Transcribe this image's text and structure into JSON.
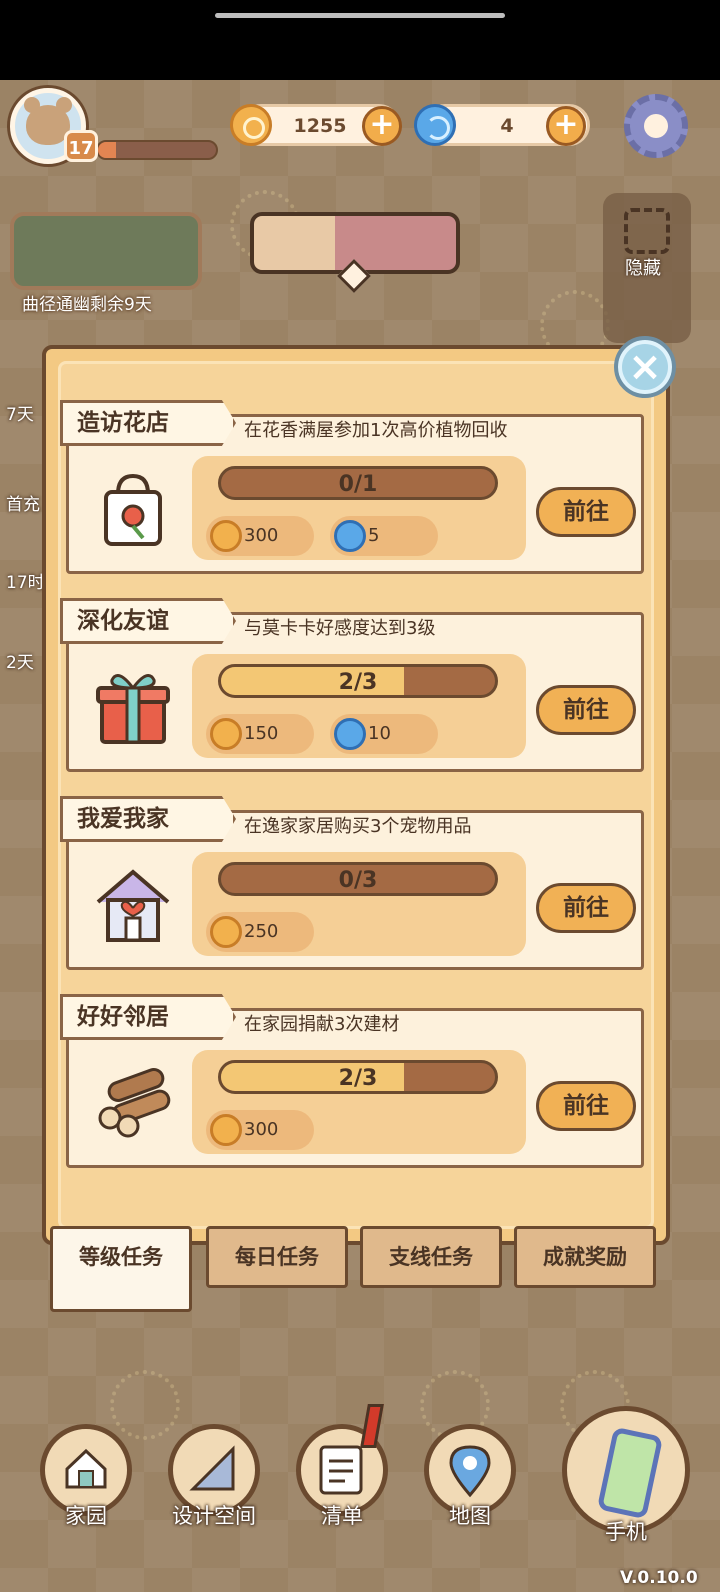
{
  "hud": {
    "level": "17",
    "xp_fraction": 0.15,
    "coins": "1255",
    "gems": "4"
  },
  "side": {
    "event_caption": "曲径通幽剩余9天",
    "hide_label": "隐藏",
    "strip_texts": [
      "7天",
      "首充",
      "17时",
      "2天"
    ]
  },
  "tasks": [
    {
      "title": "造访花店",
      "desc": "在花香满屋参加1次高价植物回收",
      "icon": "flower-bag-icon",
      "progress_text": "0/1",
      "progress_fraction": 0.0,
      "rewards": [
        {
          "type": "coin",
          "amount": "300"
        },
        {
          "type": "gem",
          "amount": "5"
        }
      ],
      "button": "前往"
    },
    {
      "title": "深化友谊",
      "desc": "与莫卡卡好感度达到3级",
      "icon": "gift-box-icon",
      "progress_text": "2/3",
      "progress_fraction": 0.667,
      "rewards": [
        {
          "type": "coin",
          "amount": "150"
        },
        {
          "type": "gem",
          "amount": "10"
        }
      ],
      "button": "前往"
    },
    {
      "title": "我爱我家",
      "desc": "在逸家家居购买3个宠物用品",
      "icon": "house-heart-icon",
      "progress_text": "0/3",
      "progress_fraction": 0.0,
      "rewards": [
        {
          "type": "coin",
          "amount": "250"
        }
      ],
      "button": "前往"
    },
    {
      "title": "好好邻居",
      "desc": "在家园捐献3次建材",
      "icon": "wood-logs-icon",
      "progress_text": "2/3",
      "progress_fraction": 0.667,
      "rewards": [
        {
          "type": "coin",
          "amount": "300"
        }
      ],
      "button": "前往"
    }
  ],
  "tabs": [
    {
      "label": "等级任务",
      "active": true
    },
    {
      "label": "每日任务",
      "active": false
    },
    {
      "label": "支线任务",
      "active": false
    },
    {
      "label": "成就奖励",
      "active": false
    }
  ],
  "nav": {
    "items": [
      "家园",
      "设计空间",
      "清单",
      "地图"
    ],
    "phone_label": "手机"
  },
  "version": "V.0.10.0",
  "colors": {
    "accent": "#f1b155",
    "panel": "#f6d49a",
    "card": "#fdf1dc",
    "outline": "#6b4a2f"
  }
}
